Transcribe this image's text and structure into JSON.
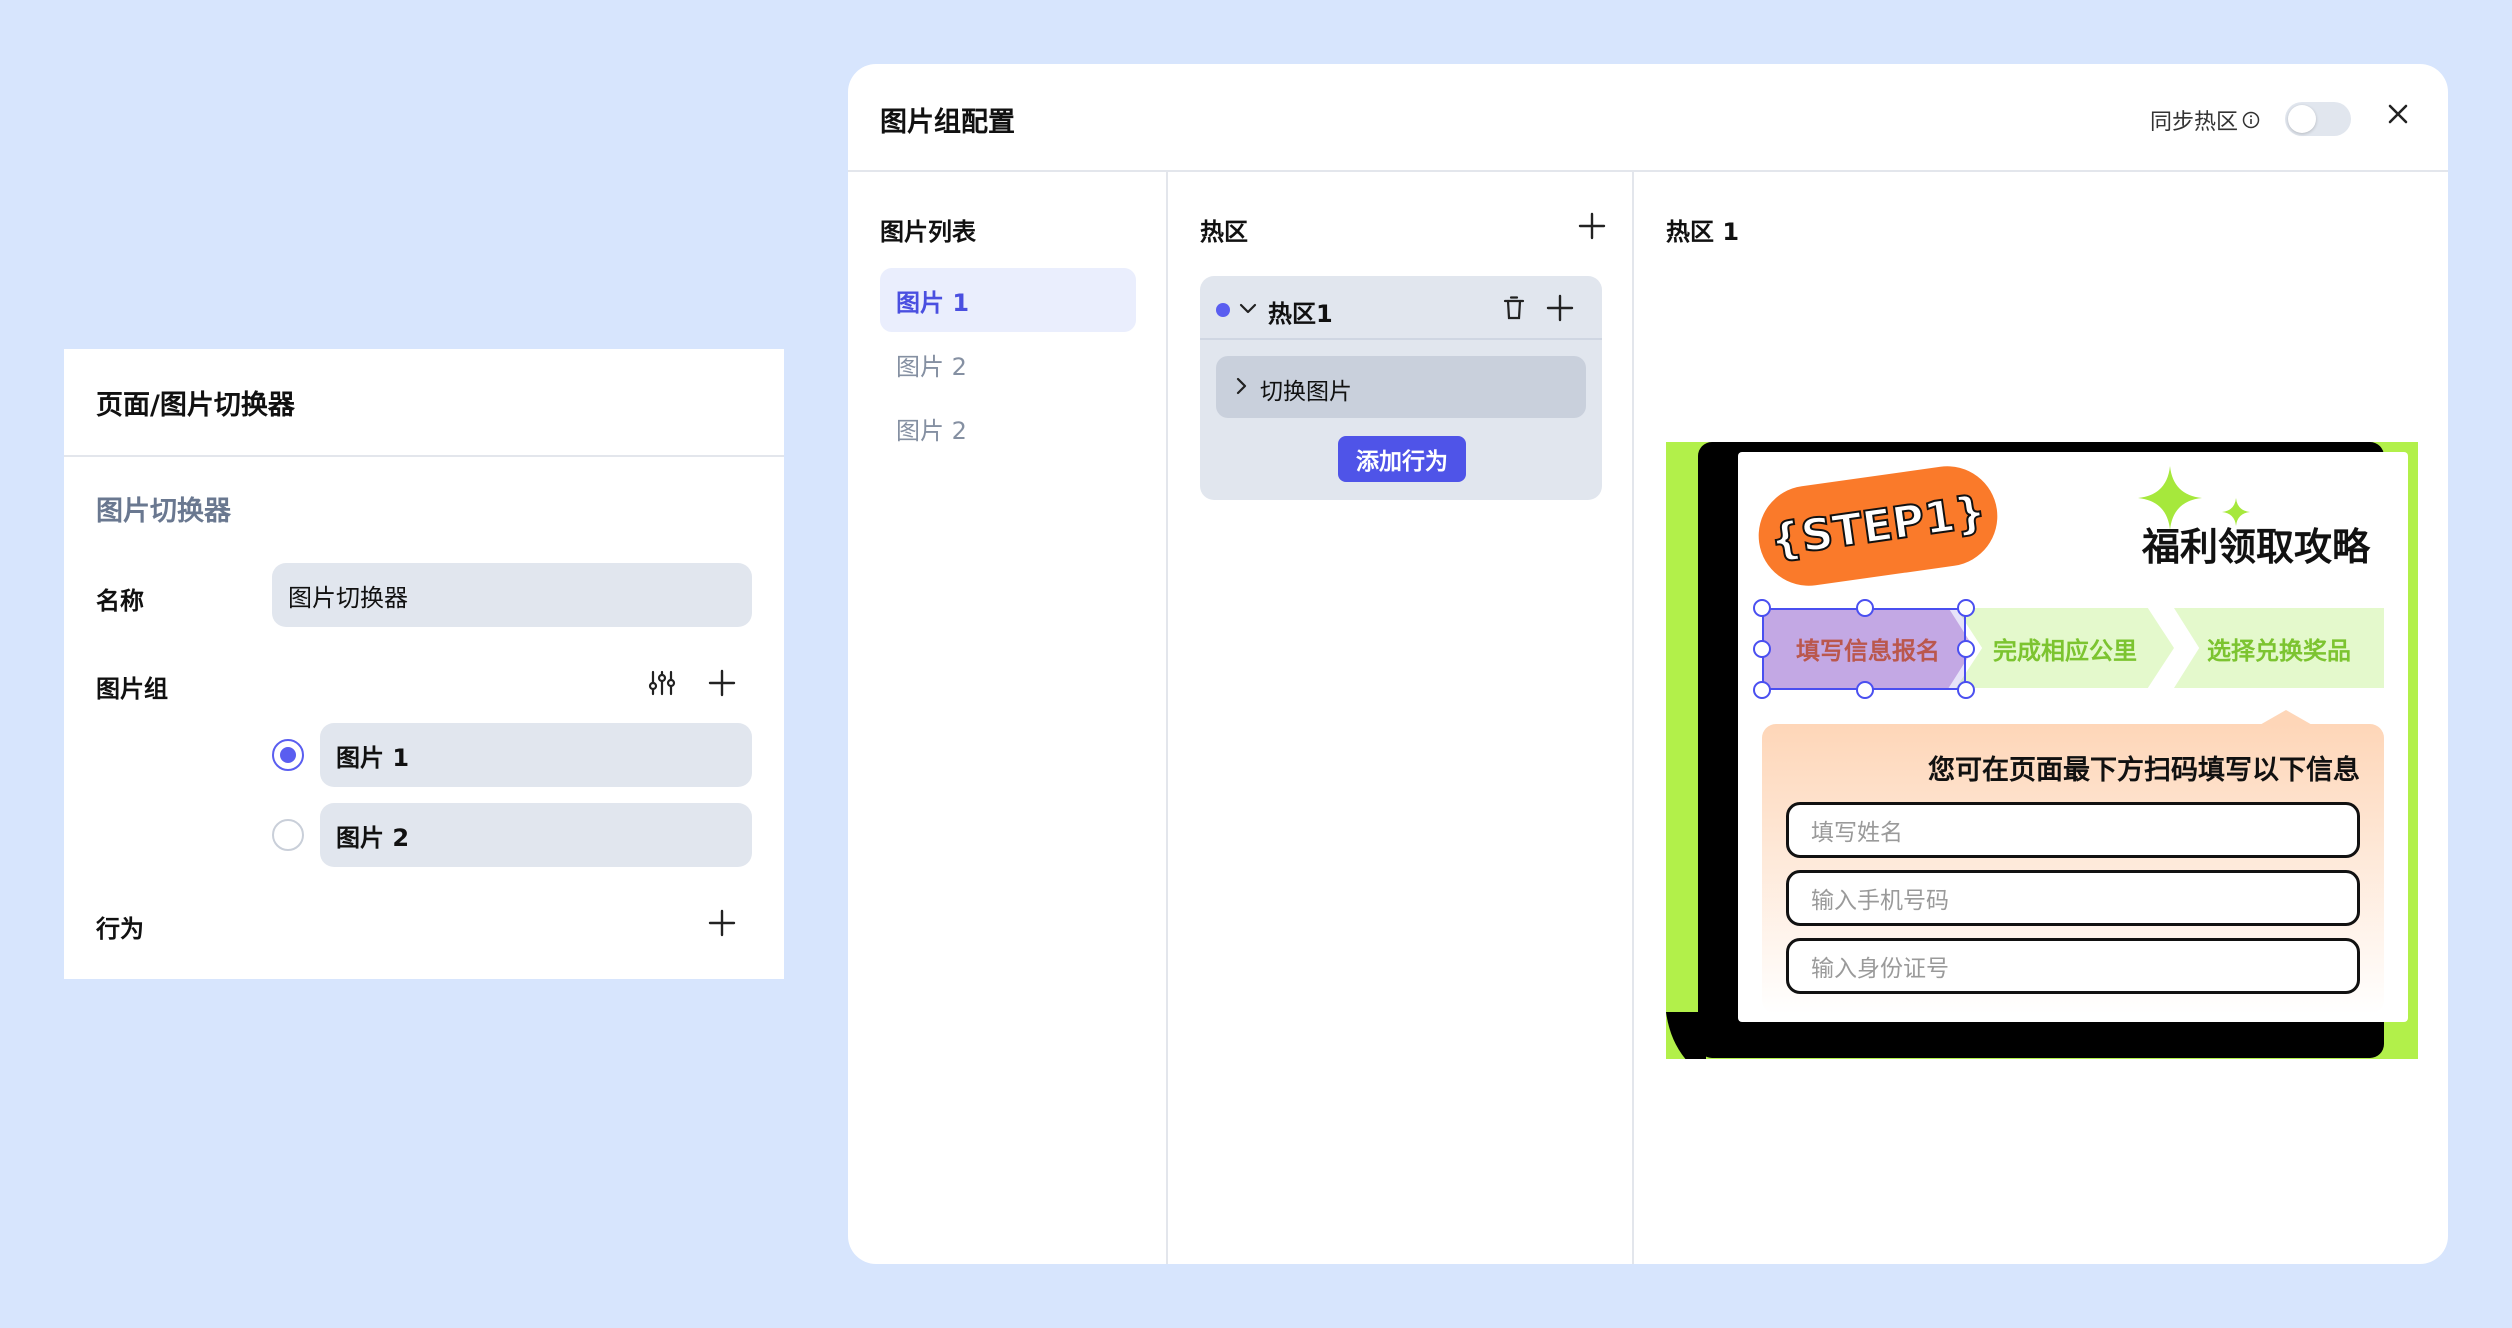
{
  "left_panel": {
    "title": "页面/图片切换器",
    "section": "图片切换器",
    "name_label": "名称",
    "name_value": "图片切换器",
    "group_label": "图片组",
    "images": [
      {
        "label": "图片 1",
        "selected": true
      },
      {
        "label": "图片 2",
        "selected": false
      }
    ],
    "behavior_label": "行为"
  },
  "modal": {
    "title": "图片组配置",
    "sync_label": "同步热区",
    "sync_info_icon": "info-icon",
    "sync_enabled": false,
    "image_list": {
      "title": "图片列表",
      "items": [
        "图片 1",
        "图片 2",
        "图片 2"
      ],
      "active_index": 0
    },
    "hotzones": {
      "title": "热区",
      "zone_name": "热区1",
      "zone_color": "#5a5ef0",
      "action_label": "切换图片",
      "add_action_label": "添加行为"
    },
    "detail": {
      "title": "热区 1",
      "image": {
        "step_badge": "{STEP1}",
        "headline": "福利领取攻略",
        "steps": [
          "填写信息报名",
          "完成相应公里",
          "选择兑换奖品"
        ],
        "form_title": "您可在页面最下方扫码填写以下信息",
        "inputs": [
          "填写姓名",
          "输入手机号码",
          "输入身份证号"
        ]
      }
    }
  },
  "colors": {
    "accent": "#5a5ef0",
    "page_bg": "#d7e5fd",
    "preview_bg": "#b2f04a",
    "step_pill": "#fa7a2a"
  }
}
